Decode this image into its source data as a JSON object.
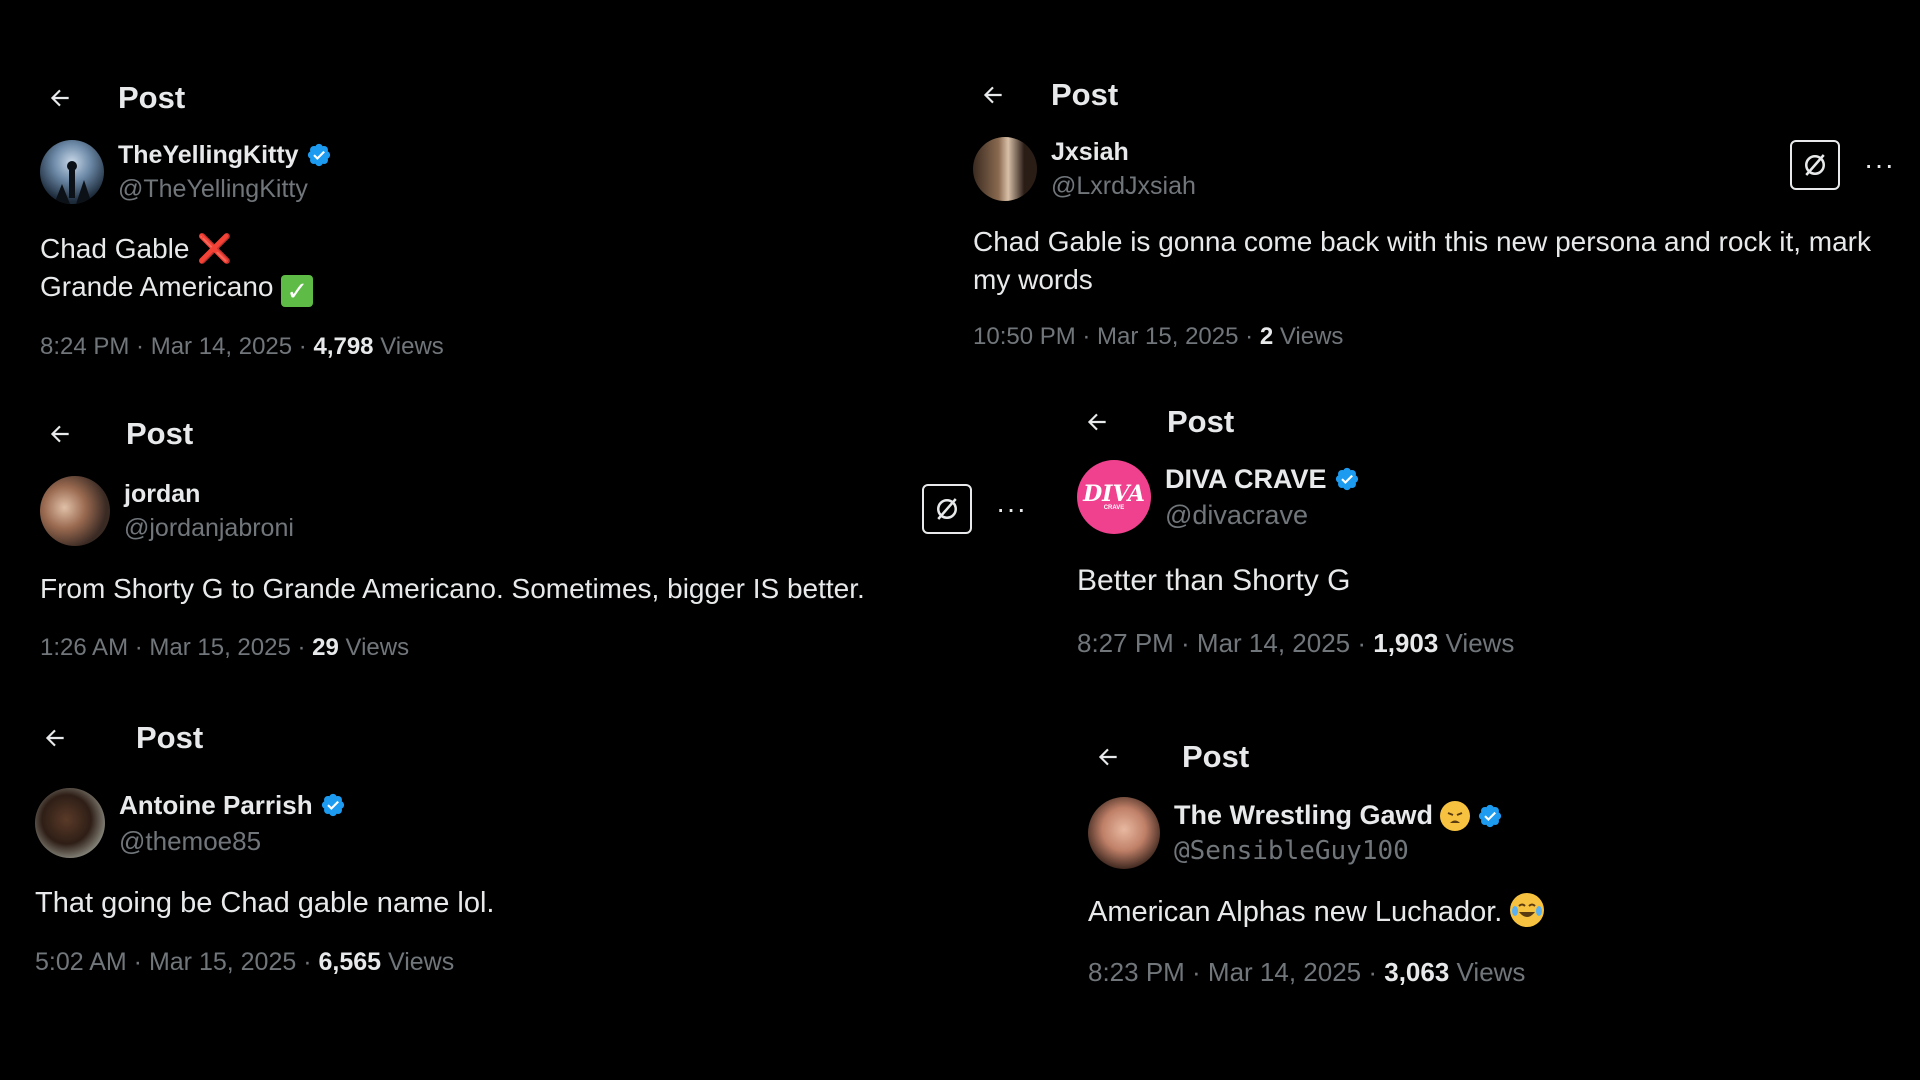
{
  "posts": [
    {
      "header_title": "Post",
      "display_name": "TheYellingKitty",
      "handle": "@TheYellingKitty",
      "verified": true,
      "text_line1": "Chad Gable",
      "text_line1_emoji": "❌",
      "text_line2": "Grande Americano",
      "text_line2_emoji": "✅",
      "timestamp": "8:24 PM · Mar 14, 2025 · ",
      "views_count": "4,798",
      "views_label": " Views"
    },
    {
      "header_title": "Post",
      "display_name": "Jxsiah",
      "handle": "@LxrdJxsiah",
      "verified": false,
      "text": "Chad Gable is gonna come back with this new persona and rock it, mark my words",
      "timestamp": "10:50 PM · Mar 15, 2025 · ",
      "views_count": "2",
      "views_label": " Views",
      "more_label": "···"
    },
    {
      "header_title": "Post",
      "display_name": "jordan",
      "handle": "@jordanjabroni",
      "verified": false,
      "text": "From Shorty G to Grande Americano. Sometimes, bigger IS better.",
      "timestamp": "1:26 AM · Mar 15, 2025 · ",
      "views_count": "29",
      "views_label": " Views",
      "more_label": "···"
    },
    {
      "header_title": "Post",
      "display_name": "DIVA CRAVE",
      "handle": "@divacrave",
      "verified": true,
      "avatar_text": "DIVA",
      "avatar_subtext": "CRAVE",
      "text": "Better than Shorty G",
      "timestamp": "8:27 PM · Mar 14, 2025 · ",
      "views_count": "1,903",
      "views_label": " Views"
    },
    {
      "header_title": "Post",
      "display_name": "Antoine Parrish",
      "handle": "@themoe85",
      "verified": true,
      "text": "That going be Chad gable name lol.",
      "timestamp": "5:02 AM · Mar 15, 2025 · ",
      "views_count": "6,565",
      "views_label": " Views"
    },
    {
      "header_title": "Post",
      "display_name": "The Wrestling Gawd",
      "handle": "@SensibleGuy100",
      "verified": true,
      "name_emoji": "😩",
      "text": "American Alphas new Luchador.",
      "text_emoji": "😂",
      "timestamp": "8:23 PM · Mar 14, 2025 · ",
      "views_count": "3,063",
      "views_label": " Views"
    }
  ],
  "colors": {
    "background": "#000000",
    "text_primary": "#e7e9ea",
    "text_secondary": "#71767b",
    "verified_blue": "#1d9bf0"
  },
  "icons": [
    "back-arrow-icon",
    "verified-badge-icon",
    "grok-icon",
    "more-icon"
  ]
}
